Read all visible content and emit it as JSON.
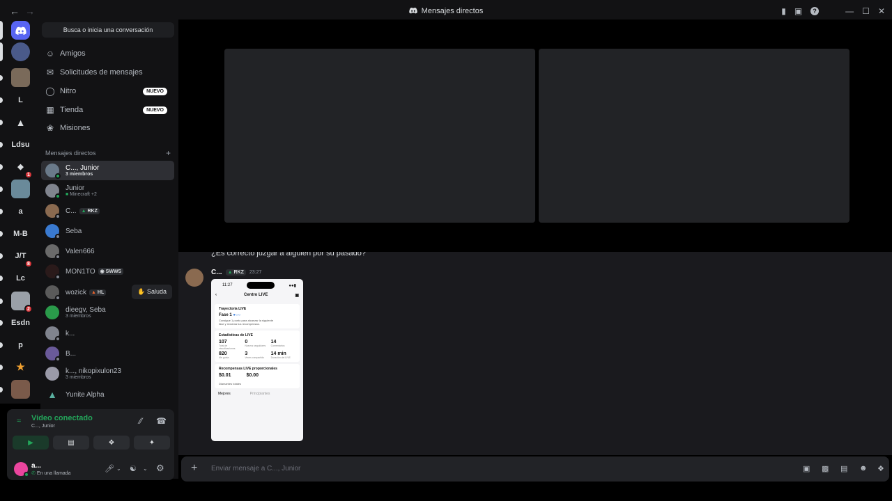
{
  "titlebar": {
    "title": "Mensajes directos"
  },
  "guilds": {
    "items": [
      {
        "label": "",
        "color": "#5865f2"
      },
      {
        "label": "",
        "color": "#4a5a8a"
      },
      {
        "label": "",
        "color": "#7a6a5a"
      },
      {
        "label": "L",
        "color": "#121214"
      },
      {
        "label": "",
        "color": "#121214"
      },
      {
        "label": "Ldsu",
        "color": "#121214"
      },
      {
        "label": "",
        "color": "#121214",
        "badge": "1"
      },
      {
        "label": "",
        "color": "#6a8a9a"
      },
      {
        "label": "a",
        "color": "#121214"
      },
      {
        "label": "M-B",
        "color": "#121214"
      },
      {
        "label": "J/T",
        "color": "#121214",
        "badge": "8"
      },
      {
        "label": "Lc",
        "color": "#121214"
      },
      {
        "label": "",
        "color": "#9aa0a8",
        "badge": "2"
      },
      {
        "label": "Esdn",
        "color": "#121214"
      },
      {
        "label": "p",
        "color": "#121214"
      },
      {
        "label": "",
        "color": "#121214"
      },
      {
        "label": "",
        "color": "#7a5a4a"
      }
    ]
  },
  "sidebar": {
    "search_label": "Busca o inicia una conversación",
    "nav": [
      {
        "label": "Amigos"
      },
      {
        "label": "Solicitudes de mensajes"
      },
      {
        "label": "Nitro",
        "badge": "NUEVO"
      },
      {
        "label": "Tienda",
        "badge": "NUEVO"
      },
      {
        "label": "Misiones"
      }
    ],
    "dm_header": "Mensajes directos",
    "dms": [
      {
        "name": "C..., Junior",
        "sub": "3 miembros",
        "active": true
      },
      {
        "name": "Junior",
        "sub": "Minecraft +2"
      },
      {
        "name": "C...",
        "tag": "RKZ"
      },
      {
        "name": "Seba"
      },
      {
        "name": "Valen666"
      },
      {
        "name": "MON1TO",
        "tag": "SWWS"
      },
      {
        "name": "wozick",
        "tag": "HL",
        "action": "Saluda"
      },
      {
        "name": "dieegv, Seba",
        "sub": "3 miembros"
      },
      {
        "name": "k..."
      },
      {
        "name": "B..."
      },
      {
        "name": "k..., nikopixulon23",
        "sub": "3 miembros"
      },
      {
        "name": "Yunite Alpha"
      }
    ]
  },
  "voice": {
    "title": "Video conectado",
    "sub": "C..., Junior"
  },
  "user": {
    "name": "a...",
    "status": "En una llamada"
  },
  "chat": {
    "prev_text": "¿Es correcto juzgar a alguien por su pasado?",
    "message": {
      "author": "C...",
      "tag": "RKZ",
      "time": "23:27"
    },
    "phone": {
      "time": "11:27",
      "screen_title": "Centro LIVE",
      "card1_title": "Trayectoria LIVE",
      "card1_phase": "Fase 1",
      "card1_text": "Consigue 1 punto para alcanzar la siguiente fase y reclama tus recompensas.",
      "card2_title": "Estadísticas de LIVE",
      "stats": [
        {
          "v": "107",
          "l": "Total de visualizaciones"
        },
        {
          "v": "0",
          "l": "Nuevos seguidores"
        },
        {
          "v": "14",
          "l": "Comentarios"
        },
        {
          "v": "820",
          "l": "Me gusta"
        },
        {
          "v": "3",
          "l": "Veces compartido"
        },
        {
          "v": "14 min",
          "l": "Duración del LIVE"
        }
      ],
      "card3_title": "Recompensas LIVE proporcionales",
      "reward1": "$0.01",
      "reward2": "$0.00",
      "diamonds": "Diamantes totales",
      "tab1": "Mejores",
      "tab2": "Principiantes"
    }
  },
  "composer": {
    "placeholder": "Enviar mensaje a C..., Junior"
  }
}
